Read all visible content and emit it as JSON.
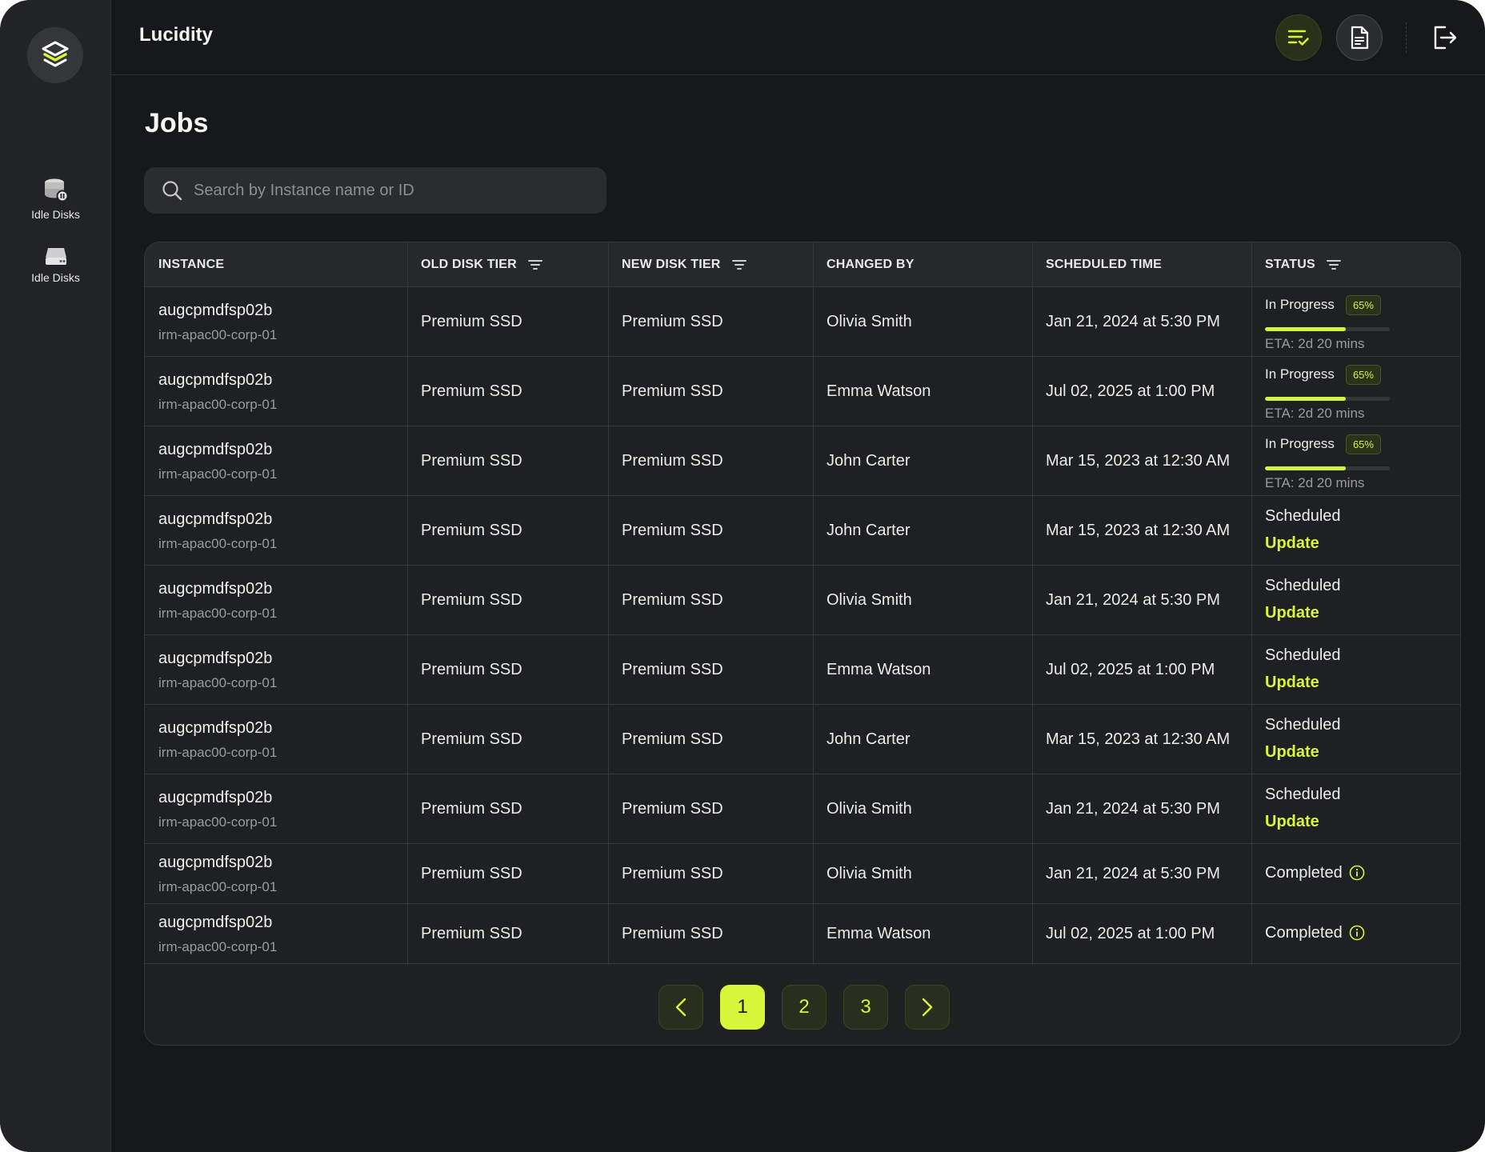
{
  "app": {
    "brand": "Lucidity"
  },
  "sidebar": {
    "items": [
      {
        "label": "Idle Disks",
        "icon": "database-disk-icon"
      },
      {
        "label": "Idle Disks",
        "icon": "hard-drive-icon"
      }
    ]
  },
  "header": {
    "actions": [
      "jobs-list-icon",
      "document-icon",
      "logout-icon"
    ]
  },
  "page": {
    "title": "Jobs"
  },
  "search": {
    "placeholder": "Search by Instance name or ID"
  },
  "table": {
    "columns": {
      "instance": "INSTANCE",
      "old_tier": "OLD DISK TIER",
      "new_tier": "NEW DISK TIER",
      "changed_by": "CHANGED BY",
      "scheduled_time": "SCHEDULED TIME",
      "status": "STATUS"
    },
    "rows": [
      {
        "name": "augcpmdfsp02b",
        "id": "irm-apac00-corp-01",
        "old_tier": "Premium SSD",
        "new_tier": "Premium SSD",
        "changed_by": "Olivia Smith",
        "time": "Jan 21, 2024 at 5:30 PM",
        "status": "In Progress",
        "percent": "65%",
        "progress": 0.65,
        "eta": "ETA: 2d 20 mins"
      },
      {
        "name": "augcpmdfsp02b",
        "id": "irm-apac00-corp-01",
        "old_tier": "Premium SSD",
        "new_tier": "Premium SSD",
        "changed_by": "Emma Watson",
        "time": "Jul 02, 2025 at 1:00 PM",
        "status": "In Progress",
        "percent": "65%",
        "progress": 0.65,
        "eta": "ETA: 2d 20 mins"
      },
      {
        "name": "augcpmdfsp02b",
        "id": "irm-apac00-corp-01",
        "old_tier": "Premium SSD",
        "new_tier": "Premium SSD",
        "changed_by": "John Carter",
        "time": "Mar 15, 2023 at 12:30 AM",
        "status": "In Progress",
        "percent": "65%",
        "progress": 0.65,
        "eta": "ETA: 2d 20 mins"
      },
      {
        "name": "augcpmdfsp02b",
        "id": "irm-apac00-corp-01",
        "old_tier": "Premium SSD",
        "new_tier": "Premium SSD",
        "changed_by": "John Carter",
        "time": "Mar 15, 2023 at 12:30 AM",
        "status": "Scheduled",
        "action": "Update"
      },
      {
        "name": "augcpmdfsp02b",
        "id": "irm-apac00-corp-01",
        "old_tier": "Premium SSD",
        "new_tier": "Premium SSD",
        "changed_by": "Olivia Smith",
        "time": "Jan 21, 2024 at 5:30 PM",
        "status": "Scheduled",
        "action": "Update"
      },
      {
        "name": "augcpmdfsp02b",
        "id": "irm-apac00-corp-01",
        "old_tier": "Premium SSD",
        "new_tier": "Premium SSD",
        "changed_by": "Emma Watson",
        "time": "Jul 02, 2025 at 1:00 PM",
        "status": "Scheduled",
        "action": "Update"
      },
      {
        "name": "augcpmdfsp02b",
        "id": "irm-apac00-corp-01",
        "old_tier": "Premium SSD",
        "new_tier": "Premium SSD",
        "changed_by": "John Carter",
        "time": "Mar 15, 2023 at 12:30 AM",
        "status": "Scheduled",
        "action": "Update"
      },
      {
        "name": "augcpmdfsp02b",
        "id": "irm-apac00-corp-01",
        "old_tier": "Premium SSD",
        "new_tier": "Premium SSD",
        "changed_by": "Olivia Smith",
        "time": "Jan 21, 2024 at 5:30 PM",
        "status": "Scheduled",
        "action": "Update"
      },
      {
        "name": "augcpmdfsp02b",
        "id": "irm-apac00-corp-01",
        "old_tier": "Premium SSD",
        "new_tier": "Premium SSD",
        "changed_by": "Olivia Smith",
        "time": "Jan 21, 2024 at 5:30 PM",
        "status": "Completed"
      },
      {
        "name": "augcpmdfsp02b",
        "id": "irm-apac00-corp-01",
        "old_tier": "Premium SSD",
        "new_tier": "Premium SSD",
        "changed_by": "Emma Watson",
        "time": "Jul 02, 2025 at 1:00 PM",
        "status": "Completed"
      }
    ]
  },
  "pagination": {
    "pages": [
      "1",
      "2",
      "3"
    ],
    "current": "1"
  },
  "colors": {
    "accent": "#d7f53a",
    "background": "#17181a",
    "sidebar": "#222326",
    "card": "#1f2022"
  }
}
